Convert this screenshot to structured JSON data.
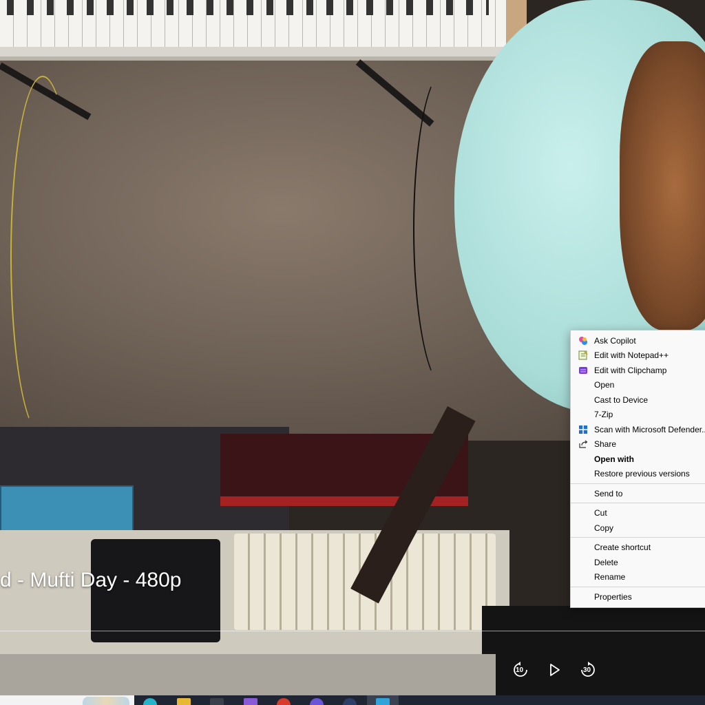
{
  "video": {
    "title": "d - Mufti Day - 480p",
    "controls": {
      "rewind_seconds": "10",
      "forward_seconds": "30"
    }
  },
  "context_menu": {
    "items": [
      {
        "label": "Ask Copilot",
        "icon": "copilot-icon"
      },
      {
        "label": "Edit with Notepad++",
        "icon": "notepad-plus-plus-icon"
      },
      {
        "label": "Edit with Clipchamp",
        "icon": "clipchamp-icon"
      },
      {
        "label": "Open",
        "icon": ""
      },
      {
        "label": "Cast to Device",
        "icon": ""
      },
      {
        "label": "7-Zip",
        "icon": ""
      },
      {
        "label": "Scan with Microsoft Defender...",
        "icon": "defender-icon"
      },
      {
        "label": "Share",
        "icon": "share-icon"
      },
      {
        "label": "Open with",
        "icon": ""
      },
      {
        "label": "Restore previous versions",
        "icon": ""
      },
      {
        "label": "Send to",
        "icon": ""
      },
      {
        "label": "Cut",
        "icon": ""
      },
      {
        "label": "Copy",
        "icon": ""
      },
      {
        "label": "Create shortcut",
        "icon": ""
      },
      {
        "label": "Delete",
        "icon": ""
      },
      {
        "label": "Rename",
        "icon": ""
      },
      {
        "label": "Properties",
        "icon": ""
      }
    ]
  },
  "colors": {
    "menu_background": "#f9f9f9",
    "taskbar": "#1f2532",
    "copilot": "#e64aa2",
    "clipchamp": "#7a3ae0",
    "defender": "#1f6fd1"
  }
}
